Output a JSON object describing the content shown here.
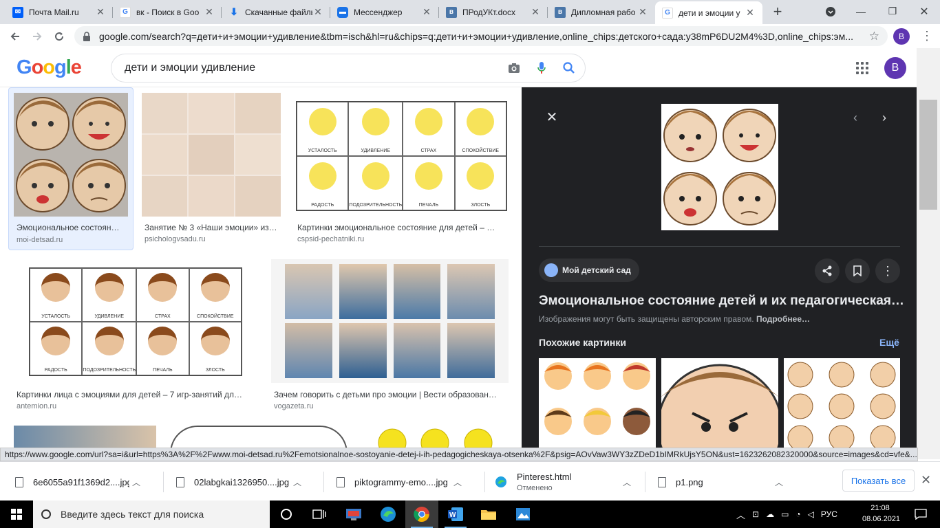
{
  "browser": {
    "tabs": [
      {
        "label": "Почта Mail.ru",
        "icon": "mail-icon"
      },
      {
        "label": "вк - Поиск в Goo",
        "icon": "google-icon"
      },
      {
        "label": "Скачанные файлы",
        "icon": "download-icon"
      },
      {
        "label": "Мессенджер",
        "icon": "messenger-icon"
      },
      {
        "label": "ПРодУКт.docx",
        "icon": "vk-icon"
      },
      {
        "label": "Дипломная рабо",
        "icon": "vk-icon"
      },
      {
        "label": "дети и эмоции у",
        "icon": "google-icon"
      }
    ],
    "url": "google.com/search?q=дети+и+эмоции+удивление&tbm=isch&hl=ru&chips=q:дети+и+эмоции+удивление,online_chips:детского+сада:y38mP6DU2M4%3D,online_chips:эм...",
    "profile_initial": "B"
  },
  "google": {
    "logo": "Google",
    "query": "дети и эмоции удивление",
    "avatar_initial": "B"
  },
  "results": [
    {
      "title": "Эмоциональное состоян…",
      "source": "moi-detsad.ru"
    },
    {
      "title": "Занятие № 3 «Наши эмоции» из…",
      "source": "psichologvsadu.ru"
    },
    {
      "title": "Картинки эмоциональное состояние для детей – …",
      "source": "cspsid-pechatniki.ru"
    },
    {
      "title": "Картинки лица с эмоциями для детей – 7 игр-занятий дл…",
      "source": "antemion.ru"
    },
    {
      "title": "Зачем говорить с детьми про эмоции | Вести образован…",
      "source": "vogazeta.ru"
    }
  ],
  "emotion_labels": [
    "УСТАЛОСТЬ",
    "УДИВЛЕНИЕ",
    "СТРАХ",
    "СПОКОЙСТВИЕ",
    "РАДОСТЬ",
    "ПОДОЗРИТЕЛЬНОСТЬ",
    "ПЕЧАЛЬ",
    "ЗЛОСТЬ"
  ],
  "preview": {
    "site": "Мой детский сад",
    "title": "Эмоциональное состояние детей и их педагогическая…",
    "copyright_text": "Изображения могут быть защищены авторским правом.",
    "copyright_more": "Подробнее…",
    "similar_label": "Похожие картинки",
    "more_label": "Ещё"
  },
  "status_url": "https://www.google.com/url?sa=i&url=https%3A%2F%2Fwww.moi-detsad.ru%2Femotsionalnoe-sostoyanie-detej-i-ih-pedagogicheskaya-otsenka%2F&psig=AOvVaw3WY3zZDeD1bIMRkUjsY5ON&ust=1623262082320000&source=images&cd=vfe&...",
  "downloads": {
    "items": [
      {
        "name": "6e6055a91f1369d2....jpg",
        "status": ""
      },
      {
        "name": "02labgkai1326950....jpg",
        "status": ""
      },
      {
        "name": "piktogrammy-emo....jpg",
        "status": ""
      },
      {
        "name": "Pinterest.html",
        "status": "Отменено"
      },
      {
        "name": "p1.png",
        "status": ""
      }
    ],
    "show_all": "Показать все"
  },
  "taskbar": {
    "search_placeholder": "Введите здесь текст для поиска",
    "lang": "РУС",
    "time": "21:08",
    "date": "08.06.2021"
  },
  "colors": {
    "accent_blue": "#1a73e8",
    "panel_bg": "#202124",
    "tabstrip_bg": "#dee1e6"
  }
}
